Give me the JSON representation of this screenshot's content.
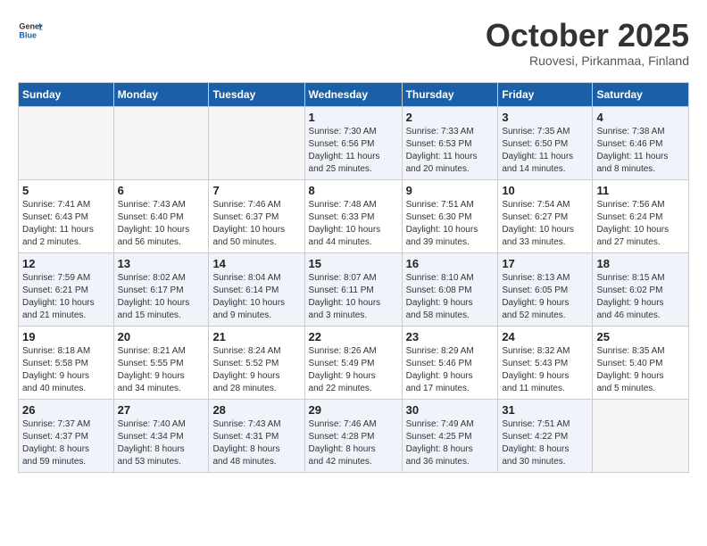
{
  "header": {
    "logo_general": "General",
    "logo_blue": "Blue",
    "month": "October 2025",
    "location": "Ruovesi, Pirkanmaa, Finland"
  },
  "days_of_week": [
    "Sunday",
    "Monday",
    "Tuesday",
    "Wednesday",
    "Thursday",
    "Friday",
    "Saturday"
  ],
  "weeks": [
    [
      {
        "day": "",
        "info": ""
      },
      {
        "day": "",
        "info": ""
      },
      {
        "day": "",
        "info": ""
      },
      {
        "day": "1",
        "info": "Sunrise: 7:30 AM\nSunset: 6:56 PM\nDaylight: 11 hours\nand 25 minutes."
      },
      {
        "day": "2",
        "info": "Sunrise: 7:33 AM\nSunset: 6:53 PM\nDaylight: 11 hours\nand 20 minutes."
      },
      {
        "day": "3",
        "info": "Sunrise: 7:35 AM\nSunset: 6:50 PM\nDaylight: 11 hours\nand 14 minutes."
      },
      {
        "day": "4",
        "info": "Sunrise: 7:38 AM\nSunset: 6:46 PM\nDaylight: 11 hours\nand 8 minutes."
      }
    ],
    [
      {
        "day": "5",
        "info": "Sunrise: 7:41 AM\nSunset: 6:43 PM\nDaylight: 11 hours\nand 2 minutes."
      },
      {
        "day": "6",
        "info": "Sunrise: 7:43 AM\nSunset: 6:40 PM\nDaylight: 10 hours\nand 56 minutes."
      },
      {
        "day": "7",
        "info": "Sunrise: 7:46 AM\nSunset: 6:37 PM\nDaylight: 10 hours\nand 50 minutes."
      },
      {
        "day": "8",
        "info": "Sunrise: 7:48 AM\nSunset: 6:33 PM\nDaylight: 10 hours\nand 44 minutes."
      },
      {
        "day": "9",
        "info": "Sunrise: 7:51 AM\nSunset: 6:30 PM\nDaylight: 10 hours\nand 39 minutes."
      },
      {
        "day": "10",
        "info": "Sunrise: 7:54 AM\nSunset: 6:27 PM\nDaylight: 10 hours\nand 33 minutes."
      },
      {
        "day": "11",
        "info": "Sunrise: 7:56 AM\nSunset: 6:24 PM\nDaylight: 10 hours\nand 27 minutes."
      }
    ],
    [
      {
        "day": "12",
        "info": "Sunrise: 7:59 AM\nSunset: 6:21 PM\nDaylight: 10 hours\nand 21 minutes."
      },
      {
        "day": "13",
        "info": "Sunrise: 8:02 AM\nSunset: 6:17 PM\nDaylight: 10 hours\nand 15 minutes."
      },
      {
        "day": "14",
        "info": "Sunrise: 8:04 AM\nSunset: 6:14 PM\nDaylight: 10 hours\nand 9 minutes."
      },
      {
        "day": "15",
        "info": "Sunrise: 8:07 AM\nSunset: 6:11 PM\nDaylight: 10 hours\nand 3 minutes."
      },
      {
        "day": "16",
        "info": "Sunrise: 8:10 AM\nSunset: 6:08 PM\nDaylight: 9 hours\nand 58 minutes."
      },
      {
        "day": "17",
        "info": "Sunrise: 8:13 AM\nSunset: 6:05 PM\nDaylight: 9 hours\nand 52 minutes."
      },
      {
        "day": "18",
        "info": "Sunrise: 8:15 AM\nSunset: 6:02 PM\nDaylight: 9 hours\nand 46 minutes."
      }
    ],
    [
      {
        "day": "19",
        "info": "Sunrise: 8:18 AM\nSunset: 5:58 PM\nDaylight: 9 hours\nand 40 minutes."
      },
      {
        "day": "20",
        "info": "Sunrise: 8:21 AM\nSunset: 5:55 PM\nDaylight: 9 hours\nand 34 minutes."
      },
      {
        "day": "21",
        "info": "Sunrise: 8:24 AM\nSunset: 5:52 PM\nDaylight: 9 hours\nand 28 minutes."
      },
      {
        "day": "22",
        "info": "Sunrise: 8:26 AM\nSunset: 5:49 PM\nDaylight: 9 hours\nand 22 minutes."
      },
      {
        "day": "23",
        "info": "Sunrise: 8:29 AM\nSunset: 5:46 PM\nDaylight: 9 hours\nand 17 minutes."
      },
      {
        "day": "24",
        "info": "Sunrise: 8:32 AM\nSunset: 5:43 PM\nDaylight: 9 hours\nand 11 minutes."
      },
      {
        "day": "25",
        "info": "Sunrise: 8:35 AM\nSunset: 5:40 PM\nDaylight: 9 hours\nand 5 minutes."
      }
    ],
    [
      {
        "day": "26",
        "info": "Sunrise: 7:37 AM\nSunset: 4:37 PM\nDaylight: 8 hours\nand 59 minutes."
      },
      {
        "day": "27",
        "info": "Sunrise: 7:40 AM\nSunset: 4:34 PM\nDaylight: 8 hours\nand 53 minutes."
      },
      {
        "day": "28",
        "info": "Sunrise: 7:43 AM\nSunset: 4:31 PM\nDaylight: 8 hours\nand 48 minutes."
      },
      {
        "day": "29",
        "info": "Sunrise: 7:46 AM\nSunset: 4:28 PM\nDaylight: 8 hours\nand 42 minutes."
      },
      {
        "day": "30",
        "info": "Sunrise: 7:49 AM\nSunset: 4:25 PM\nDaylight: 8 hours\nand 36 minutes."
      },
      {
        "day": "31",
        "info": "Sunrise: 7:51 AM\nSunset: 4:22 PM\nDaylight: 8 hours\nand 30 minutes."
      },
      {
        "day": "",
        "info": ""
      }
    ]
  ]
}
